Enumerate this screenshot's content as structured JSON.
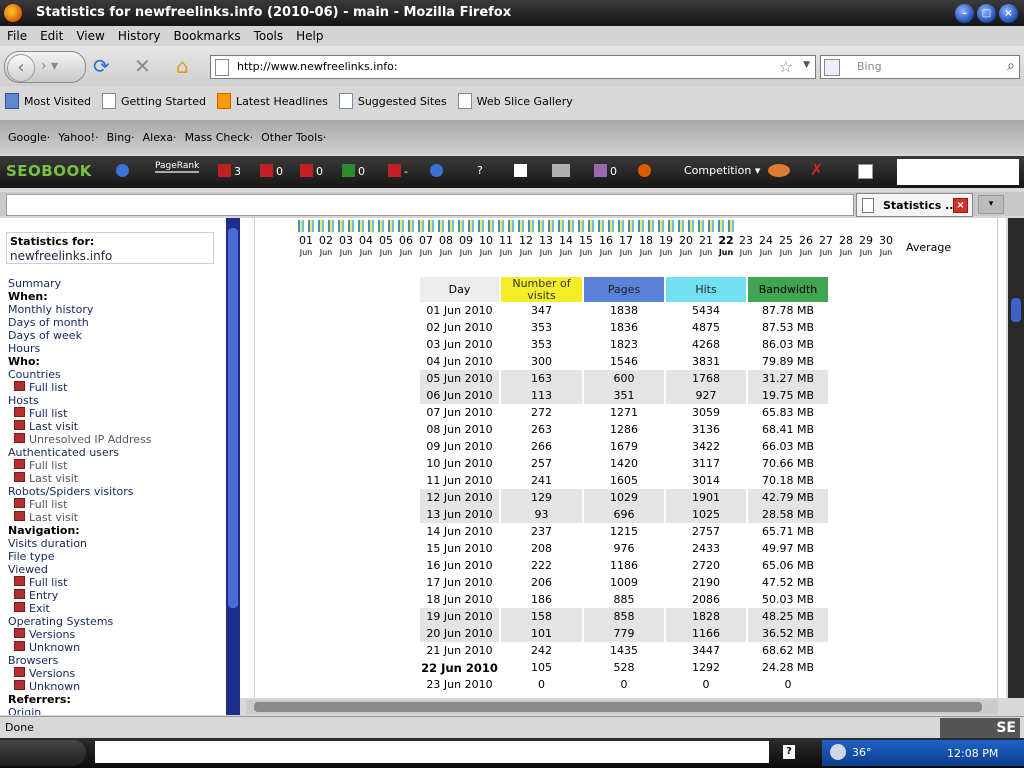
{
  "window": {
    "title": "Statistics for newfreelinks.info (2010-06) - main - Mozilla Firefox"
  },
  "menu": [
    "File",
    "Edit",
    "View",
    "History",
    "Bookmarks",
    "Tools",
    "Help"
  ],
  "nav": {
    "url": "http://www.newfreelinks.info:",
    "search_placeholder": "Bing"
  },
  "bookmarks": [
    "Most Visited",
    "Getting Started",
    "Latest Headlines",
    "Suggested Sites",
    "Web Slice Gallery"
  ],
  "engines": [
    "Google·",
    "Yahoo!·",
    "Bing·",
    "Alexa·",
    "Mass Check·",
    "Other Tools·"
  ],
  "seobar": {
    "logo": "SEOBOOK",
    "pagerank": "PageRank",
    "counts": [
      "3",
      "0",
      "0",
      "0",
      "-",
      "?",
      "0",
      "0"
    ],
    "competition": "Competition"
  },
  "tab": {
    "title": "Statistics ..."
  },
  "sidebar": {
    "stats_for_label": "Statistics for:",
    "domain": "newfreelinks.info",
    "items": [
      {
        "label": "Summary",
        "type": "link"
      },
      {
        "label": "When:",
        "type": "header"
      },
      {
        "label": "Monthly history",
        "type": "link"
      },
      {
        "label": "Days of month",
        "type": "link"
      },
      {
        "label": "Days of week",
        "type": "link"
      },
      {
        "label": "Hours",
        "type": "link"
      },
      {
        "label": "Who:",
        "type": "header"
      },
      {
        "label": "Countries",
        "type": "link"
      },
      {
        "label": "Full list",
        "type": "sub"
      },
      {
        "label": "Hosts",
        "type": "link"
      },
      {
        "label": "Full list",
        "type": "sub"
      },
      {
        "label": "Last visit",
        "type": "sub"
      },
      {
        "label": "Unresolved IP Address",
        "type": "subgray"
      },
      {
        "label": "Authenticated users",
        "type": "link"
      },
      {
        "label": "Full list",
        "type": "subgray"
      },
      {
        "label": "Last visit",
        "type": "subgray"
      },
      {
        "label": "Robots/Spiders visitors",
        "type": "link"
      },
      {
        "label": "Full list",
        "type": "subgray"
      },
      {
        "label": "Last visit",
        "type": "subgray"
      },
      {
        "label": "Navigation:",
        "type": "header"
      },
      {
        "label": "Visits duration",
        "type": "link"
      },
      {
        "label": "File type",
        "type": "link"
      },
      {
        "label": "Viewed",
        "type": "link"
      },
      {
        "label": "Full list",
        "type": "sub"
      },
      {
        "label": "Entry",
        "type": "sub"
      },
      {
        "label": "Exit",
        "type": "sub"
      },
      {
        "label": "Operating Systems",
        "type": "link"
      },
      {
        "label": "Versions",
        "type": "sub"
      },
      {
        "label": "Unknown",
        "type": "sub"
      },
      {
        "label": "Browsers",
        "type": "link"
      },
      {
        "label": "Versions",
        "type": "sub"
      },
      {
        "label": "Unknown",
        "type": "sub"
      },
      {
        "label": "Referrers:",
        "type": "header"
      },
      {
        "label": "Origin",
        "type": "link"
      }
    ]
  },
  "days_header": {
    "days": [
      "01",
      "02",
      "03",
      "04",
      "05",
      "06",
      "07",
      "08",
      "09",
      "10",
      "11",
      "12",
      "13",
      "14",
      "15",
      "16",
      "17",
      "18",
      "19",
      "20",
      "21",
      "22",
      "23",
      "24",
      "25",
      "26",
      "27",
      "28",
      "29",
      "30"
    ],
    "month_abbr": "Jun",
    "today": "22",
    "average_label": "Average"
  },
  "table": {
    "headers": {
      "day": "Day",
      "visits": "Number of visits",
      "pages": "Pages",
      "hits": "Hits",
      "bandwidth": "Bandwidth"
    },
    "rows": [
      {
        "day": "01 Jun 2010",
        "visits": "347",
        "pages": "1838",
        "hits": "5434",
        "bw": "87.78 MB",
        "weekend": false
      },
      {
        "day": "02 Jun 2010",
        "visits": "353",
        "pages": "1836",
        "hits": "4875",
        "bw": "87.53 MB",
        "weekend": false
      },
      {
        "day": "03 Jun 2010",
        "visits": "353",
        "pages": "1823",
        "hits": "4268",
        "bw": "86.03 MB",
        "weekend": false
      },
      {
        "day": "04 Jun 2010",
        "visits": "300",
        "pages": "1546",
        "hits": "3831",
        "bw": "79.89 MB",
        "weekend": false
      },
      {
        "day": "05 Jun 2010",
        "visits": "163",
        "pages": "600",
        "hits": "1768",
        "bw": "31.27 MB",
        "weekend": true
      },
      {
        "day": "06 Jun 2010",
        "visits": "113",
        "pages": "351",
        "hits": "927",
        "bw": "19.75 MB",
        "weekend": true
      },
      {
        "day": "07 Jun 2010",
        "visits": "272",
        "pages": "1271",
        "hits": "3059",
        "bw": "65.83 MB",
        "weekend": false
      },
      {
        "day": "08 Jun 2010",
        "visits": "263",
        "pages": "1286",
        "hits": "3136",
        "bw": "68.41 MB",
        "weekend": false
      },
      {
        "day": "09 Jun 2010",
        "visits": "266",
        "pages": "1679",
        "hits": "3422",
        "bw": "66.03 MB",
        "weekend": false
      },
      {
        "day": "10 Jun 2010",
        "visits": "257",
        "pages": "1420",
        "hits": "3117",
        "bw": "70.66 MB",
        "weekend": false
      },
      {
        "day": "11 Jun 2010",
        "visits": "241",
        "pages": "1605",
        "hits": "3014",
        "bw": "70.18 MB",
        "weekend": false
      },
      {
        "day": "12 Jun 2010",
        "visits": "129",
        "pages": "1029",
        "hits": "1901",
        "bw": "42.79 MB",
        "weekend": true
      },
      {
        "day": "13 Jun 2010",
        "visits": "93",
        "pages": "696",
        "hits": "1025",
        "bw": "28.58 MB",
        "weekend": true
      },
      {
        "day": "14 Jun 2010",
        "visits": "237",
        "pages": "1215",
        "hits": "2757",
        "bw": "65.71 MB",
        "weekend": false
      },
      {
        "day": "15 Jun 2010",
        "visits": "208",
        "pages": "976",
        "hits": "2433",
        "bw": "49.97 MB",
        "weekend": false
      },
      {
        "day": "16 Jun 2010",
        "visits": "222",
        "pages": "1186",
        "hits": "2720",
        "bw": "65.06 MB",
        "weekend": false
      },
      {
        "day": "17 Jun 2010",
        "visits": "206",
        "pages": "1009",
        "hits": "2190",
        "bw": "47.52 MB",
        "weekend": false
      },
      {
        "day": "18 Jun 2010",
        "visits": "186",
        "pages": "885",
        "hits": "2086",
        "bw": "50.03 MB",
        "weekend": false
      },
      {
        "day": "19 Jun 2010",
        "visits": "158",
        "pages": "858",
        "hits": "1828",
        "bw": "48.25 MB",
        "weekend": true
      },
      {
        "day": "20 Jun 2010",
        "visits": "101",
        "pages": "779",
        "hits": "1166",
        "bw": "36.52 MB",
        "weekend": true
      },
      {
        "day": "21 Jun 2010",
        "visits": "242",
        "pages": "1435",
        "hits": "3447",
        "bw": "68.62 MB",
        "weekend": false
      },
      {
        "day": "22 Jun 2010",
        "visits": "105",
        "pages": "528",
        "hits": "1292",
        "bw": "24.28 MB",
        "weekend": false,
        "today": true
      },
      {
        "day": "23 Jun 2010",
        "visits": "0",
        "pages": "0",
        "hits": "0",
        "bw": "0",
        "weekend": false
      }
    ]
  },
  "status": {
    "text": "Done",
    "seo_badge": "SE"
  },
  "tray": {
    "temperature": "36°",
    "clock": "12:08 PM"
  },
  "colors": {
    "visits": "#f4ee28",
    "pages": "#5a83d8",
    "hits": "#72e0f0",
    "bandwidth": "#3fa550"
  }
}
